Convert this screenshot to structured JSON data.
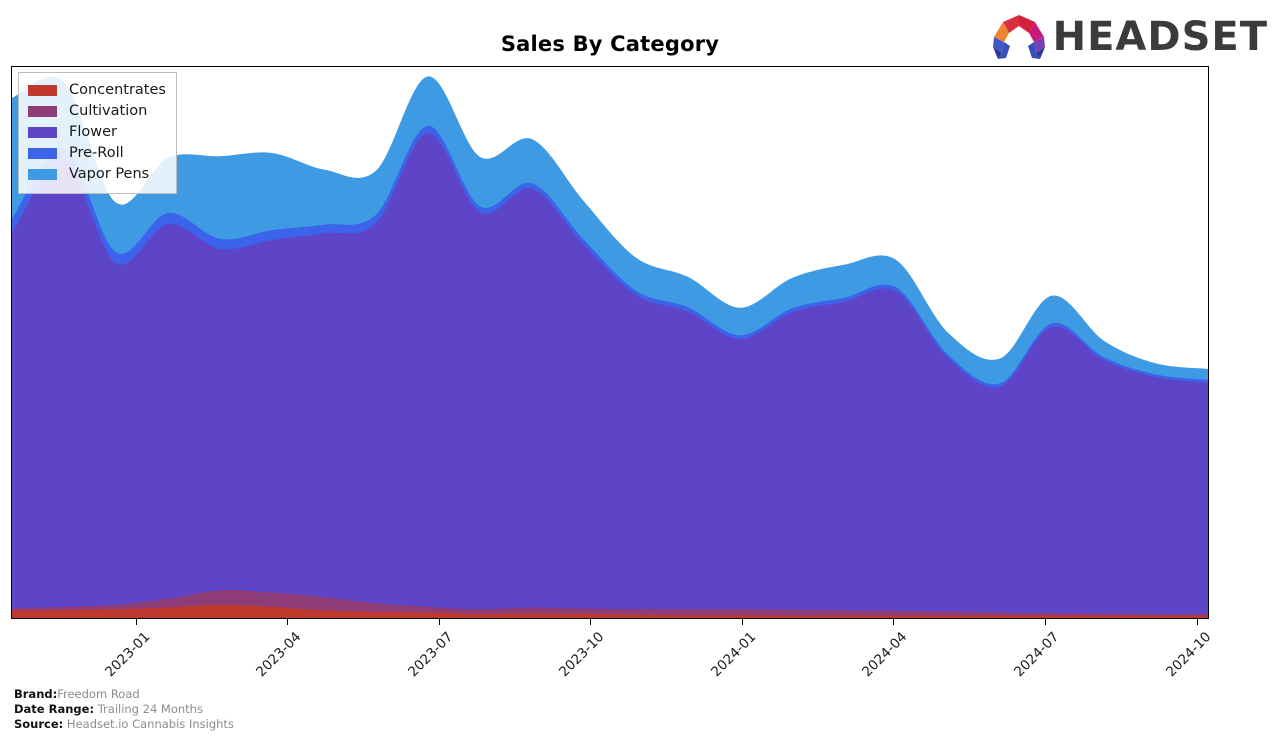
{
  "header": {
    "title": "Sales By Category",
    "logo_text": "HEADSET",
    "logo_icon": "headset-logo-icon"
  },
  "footer": {
    "rows": [
      {
        "key": "Brand:",
        "value": "Freedom Road",
        "gap": ""
      },
      {
        "key": "Date Range:",
        "value": "Trailing 24 Months",
        "gap": " "
      },
      {
        "key": "Source:",
        "value": "Headset.io Cannabis Insights",
        "gap": " "
      }
    ]
  },
  "legend": {
    "position": "upper-left",
    "entries": [
      {
        "label": "Concentrates",
        "color": "#c0392f"
      },
      {
        "label": "Cultivation",
        "color": "#8e3d78"
      },
      {
        "label": "Flower",
        "color": "#5e45c7"
      },
      {
        "label": "Pre-Roll",
        "color": "#3b64ea"
      },
      {
        "label": "Vapor Pens",
        "color": "#3d9ae3"
      }
    ]
  },
  "chart_data": {
    "type": "area",
    "stacked": true,
    "title": "Sales By Category",
    "xlabel": "",
    "ylabel": "",
    "grid": false,
    "axis": {
      "x_tick_labels": [
        "2023-01",
        "2023-04",
        "2023-07",
        "2023-10",
        "2024-01",
        "2024-04",
        "2024-07",
        "2024-10"
      ],
      "x_tick_positions_pct": [
        10.4,
        23.0,
        35.7,
        48.3,
        61.0,
        73.6,
        86.3,
        99.0
      ],
      "y_axis_visible": false,
      "ylim": [
        0,
        100
      ]
    },
    "x": [
      "2022-11",
      "2022-12",
      "2023-01",
      "2023-02",
      "2023-03",
      "2023-04",
      "2023-05",
      "2023-06",
      "2023-07",
      "2023-08",
      "2023-09",
      "2023-10",
      "2023-11",
      "2023-12",
      "2024-01",
      "2024-02",
      "2024-03",
      "2024-04",
      "2024-05",
      "2024-06",
      "2024-07",
      "2024-08",
      "2024-09",
      "2024-10"
    ],
    "series": [
      {
        "name": "Concentrates",
        "color": "#c0392f",
        "values": [
          1.3,
          1.4,
          1.6,
          1.9,
          2.4,
          2.0,
          1.4,
          1.1,
          1.0,
          0.7,
          0.8,
          0.7,
          0.6,
          0.5,
          0.5,
          0.4,
          0.4,
          0.4,
          0.4,
          0.4,
          0.4,
          0.4,
          0.4,
          0.4
        ]
      },
      {
        "name": "Cultivation",
        "color": "#8e3d78",
        "values": [
          0.5,
          0.6,
          0.8,
          1.6,
          2.6,
          2.6,
          2.4,
          1.6,
          1.0,
          0.9,
          1.1,
          1.0,
          1.0,
          1.1,
          1.1,
          1.1,
          1.0,
          0.9,
          0.8,
          0.6,
          0.5,
          0.4,
          0.3,
          0.3
        ]
      },
      {
        "name": "Flower",
        "color": "#5e45c7",
        "values": [
          68.0,
          81.0,
          62.0,
          68.0,
          62.0,
          64.0,
          66.0,
          69.0,
          86.0,
          72.0,
          76.0,
          66.0,
          57.0,
          54.0,
          49.0,
          54.0,
          56.0,
          58.0,
          46.0,
          41.0,
          52.0,
          46.0,
          43.0,
          42.0
        ]
      },
      {
        "name": "Pre-Roll",
        "color": "#3b64ea",
        "values": [
          2.6,
          2.2,
          2.0,
          2.0,
          1.8,
          1.8,
          1.6,
          1.5,
          1.3,
          1.1,
          1.0,
          0.9,
          0.8,
          0.8,
          0.7,
          0.7,
          0.7,
          0.7,
          0.6,
          0.6,
          0.6,
          0.5,
          0.5,
          0.5
        ]
      },
      {
        "name": "Vapor Pens",
        "color": "#3d9ae3",
        "values": [
          22.0,
          12.0,
          9.0,
          10.0,
          15.0,
          14.0,
          10.0,
          8.0,
          9.0,
          9.0,
          8.0,
          7.0,
          6.0,
          5.5,
          5.0,
          5.5,
          6.0,
          5.0,
          4.0,
          4.5,
          5.0,
          3.0,
          2.0,
          2.0
        ]
      }
    ]
  }
}
